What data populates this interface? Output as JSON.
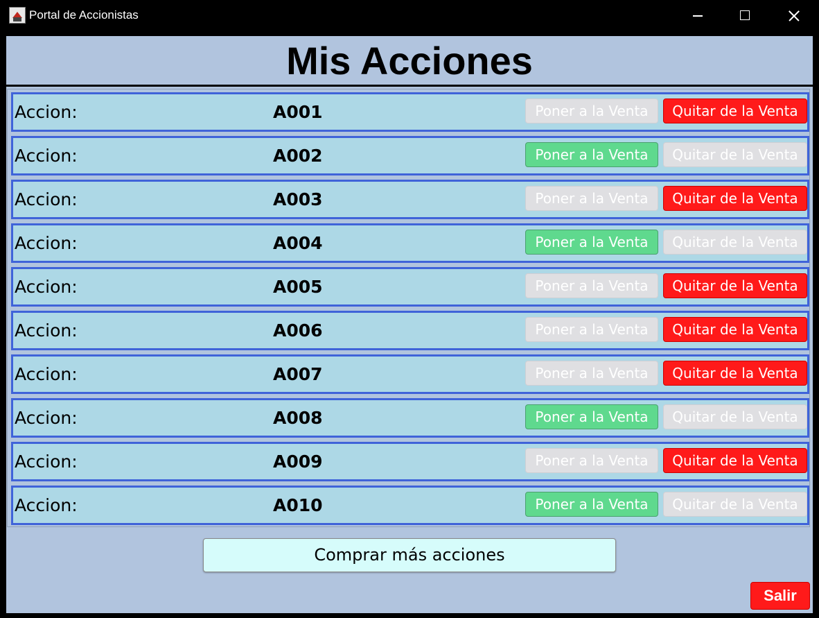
{
  "window": {
    "title": "Portal de Accionistas"
  },
  "header": {
    "title": "Mis Acciones"
  },
  "rows": [
    {
      "label": "Accion:",
      "code": "A001",
      "sell_label": "Poner a la Venta",
      "remove_label": "Quitar de la Venta",
      "on_sale": true
    },
    {
      "label": "Accion:",
      "code": "A002",
      "sell_label": "Poner a la Venta",
      "remove_label": "Quitar de la Venta",
      "on_sale": false
    },
    {
      "label": "Accion:",
      "code": "A003",
      "sell_label": "Poner a la Venta",
      "remove_label": "Quitar de la Venta",
      "on_sale": true
    },
    {
      "label": "Accion:",
      "code": "A004",
      "sell_label": "Poner a la Venta",
      "remove_label": "Quitar de la Venta",
      "on_sale": false
    },
    {
      "label": "Accion:",
      "code": "A005",
      "sell_label": "Poner a la Venta",
      "remove_label": "Quitar de la Venta",
      "on_sale": true
    },
    {
      "label": "Accion:",
      "code": "A006",
      "sell_label": "Poner a la Venta",
      "remove_label": "Quitar de la Venta",
      "on_sale": true
    },
    {
      "label": "Accion:",
      "code": "A007",
      "sell_label": "Poner a la Venta",
      "remove_label": "Quitar de la Venta",
      "on_sale": true
    },
    {
      "label": "Accion:",
      "code": "A008",
      "sell_label": "Poner a la Venta",
      "remove_label": "Quitar de la Venta",
      "on_sale": false
    },
    {
      "label": "Accion:",
      "code": "A009",
      "sell_label": "Poner a la Venta",
      "remove_label": "Quitar de la Venta",
      "on_sale": true
    },
    {
      "label": "Accion:",
      "code": "A010",
      "sell_label": "Poner a la Venta",
      "remove_label": "Quitar de la Venta",
      "on_sale": false
    }
  ],
  "footer": {
    "buy_label": "Comprar más acciones",
    "exit_label": "Salir"
  },
  "colors": {
    "sell_active": "#5fd98e",
    "remove_active": "#ff1a1a",
    "disabled": "#dfdfe2",
    "row_bg": "#add8e6",
    "row_border": "#3f63d9",
    "content_bg": "#b1c4de",
    "buy_bg": "#d6fcfb"
  },
  "icons": {
    "app": "app-icon",
    "minimize": "minimize-icon",
    "maximize": "maximize-icon",
    "close": "close-icon"
  }
}
